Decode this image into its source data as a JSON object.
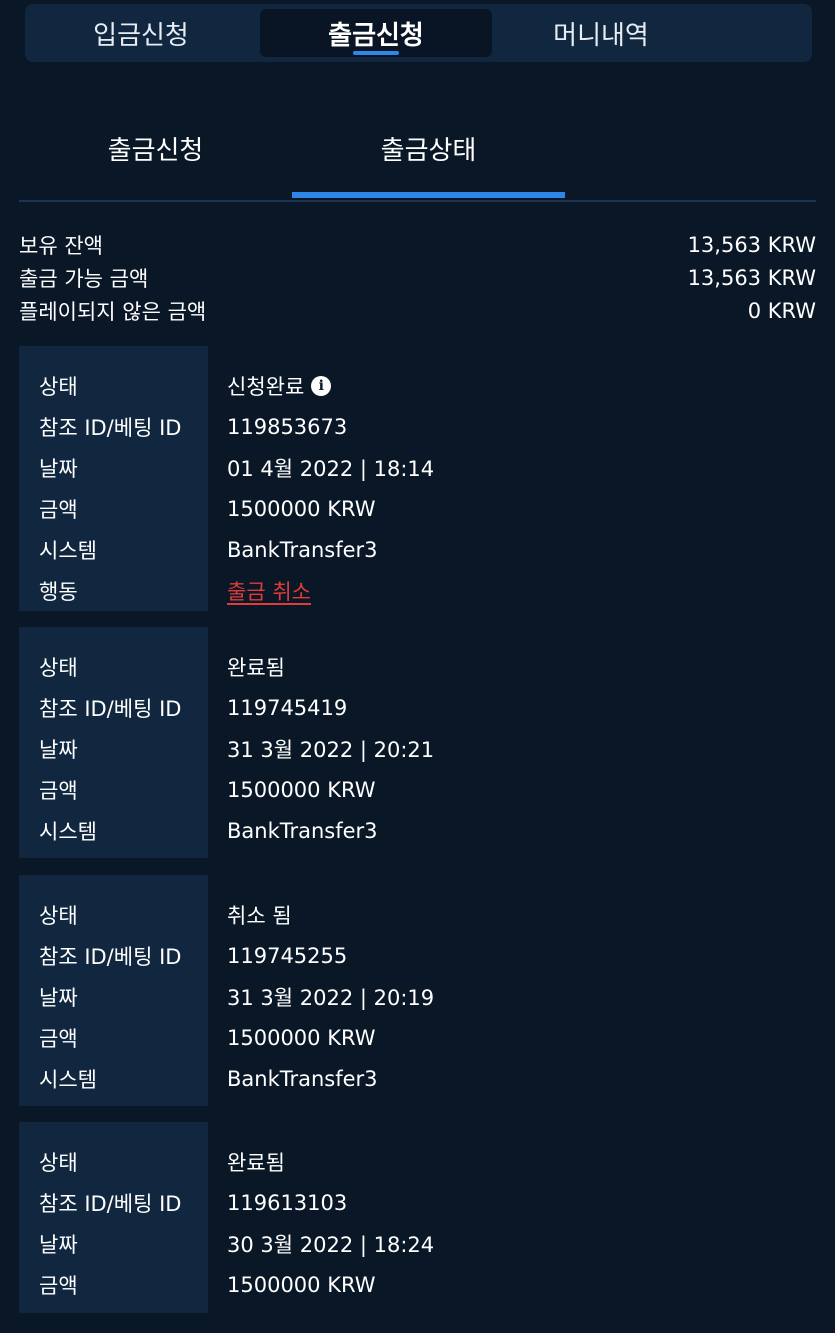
{
  "top_tabs": [
    "입금신청",
    "출금신청",
    "머니내역"
  ],
  "sub_tabs": [
    "출금신청",
    "출금상태"
  ],
  "summary": [
    {
      "label": "보유 잔액",
      "value": "13,563 KRW"
    },
    {
      "label": "출금 가능 금액",
      "value": "13,563 KRW"
    },
    {
      "label": "플레이되지 않은 금액",
      "value": "0 KRW"
    }
  ],
  "labels": {
    "status": "상태",
    "ref_id": "참조 ID/베팅 ID",
    "date": "날짜",
    "amount": "금액",
    "system": "시스템",
    "action": "행동"
  },
  "records": [
    {
      "status": "신청완료",
      "ref_id": "119853673",
      "date": "01 4월 2022 | 18:14",
      "amount": "1500000 KRW",
      "system": "BankTransfer3",
      "action": "출금 취소"
    },
    {
      "status": "완료됨",
      "ref_id": "119745419",
      "date": "31 3월 2022 | 20:21",
      "amount": "1500000 KRW",
      "system": "BankTransfer3"
    },
    {
      "status": "취소 됨",
      "ref_id": "119745255",
      "date": "31 3월 2022 | 20:19",
      "amount": "1500000 KRW",
      "system": "BankTransfer3"
    },
    {
      "status": "완료됨",
      "ref_id": "119613103",
      "date": "30 3월 2022 | 18:24",
      "amount": "1500000 KRW"
    }
  ],
  "colors": {
    "background": "#0a1727",
    "panel": "#112740",
    "accent": "#2e86e8",
    "danger": "#e23b3b"
  },
  "icons": {
    "status_info": "info-icon"
  }
}
